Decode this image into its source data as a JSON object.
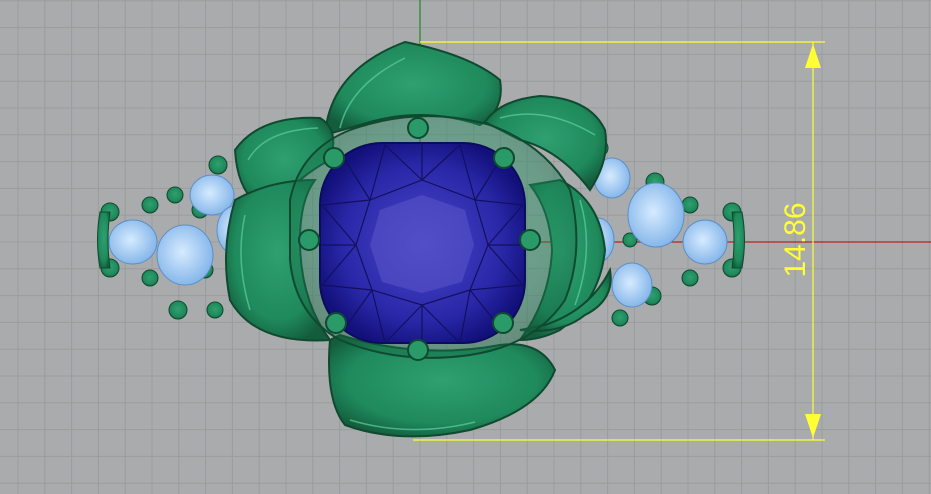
{
  "viewport": {
    "view": "Top",
    "background_color": "#a9abad",
    "grid_color": "#9a9c9e",
    "x_axis_color": "#b02525",
    "y_axis_color": "#1f8a2a"
  },
  "model": {
    "metal_color": "#1f8a5c",
    "center_stone_color": "#2a28a8",
    "accent_stone_color": "#9ec8f0"
  },
  "dimension": {
    "value": "14.86",
    "color": "#ffff33"
  }
}
